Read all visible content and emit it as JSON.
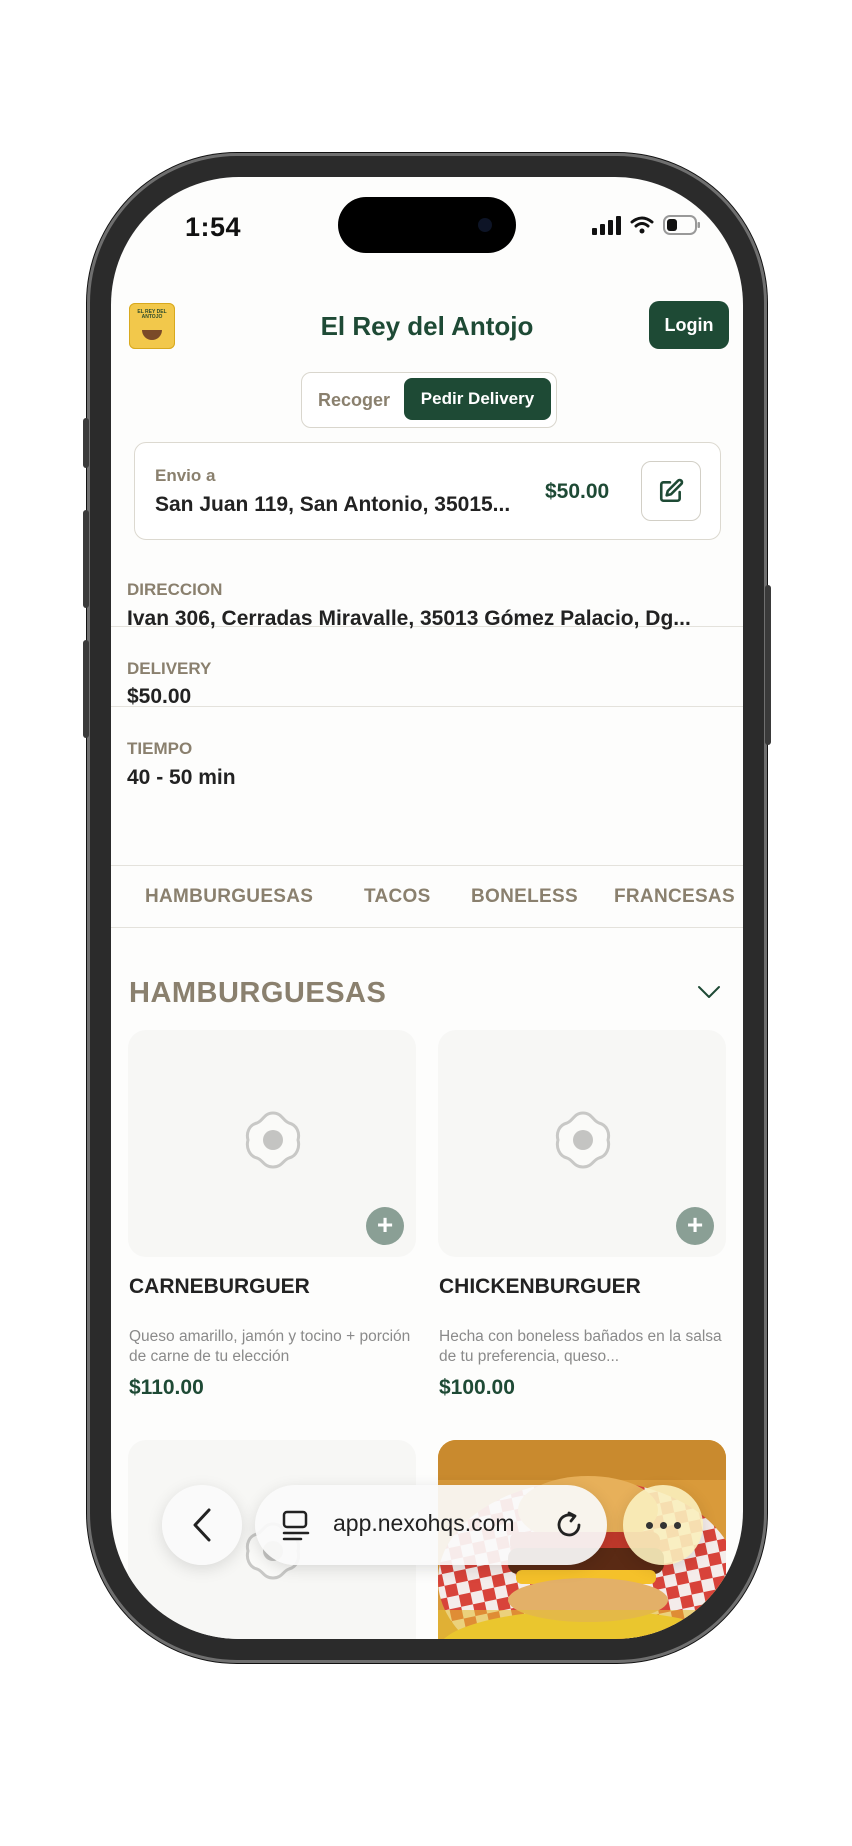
{
  "status": {
    "time": "1:54"
  },
  "header": {
    "title": "El Rey del Antojo",
    "login_label": "Login",
    "logo_text": "EL REY DEL ANTOJO"
  },
  "mode_toggle": {
    "pickup_label": "Recoger",
    "delivery_label": "Pedir Delivery",
    "selected": "delivery"
  },
  "address_card": {
    "label": "Envio a",
    "address": "San Juan 119, San Antonio, 35015...",
    "price": "$50.00"
  },
  "info": [
    {
      "label": "DIRECCION",
      "value": "Ivan 306, Cerradas Miravalle, 35013 Gómez Palacio, Dg..."
    },
    {
      "label": "DELIVERY",
      "value": "$50.00"
    },
    {
      "label": "TIEMPO",
      "value": "40 - 50 min"
    }
  ],
  "categories": [
    "HAMBURGUESAS",
    "TACOS",
    "BONELESS",
    "FRANCESAS"
  ],
  "section": {
    "title": "HAMBURGUESAS"
  },
  "products": [
    {
      "name": "CARNEBURGUER",
      "description": "Queso amarillo, jamón y tocino + porción de carne de tu elección",
      "price": "$110.00"
    },
    {
      "name": "CHICKENBURGUER",
      "description": "Hecha con boneless bañados en la salsa de tu preferencia, queso...",
      "price": "$100.00"
    }
  ],
  "browser": {
    "url": "app.nexohqs.com"
  },
  "colors": {
    "brand": "#1e4a35",
    "muted": "#8a806e",
    "add_button": "#8a9f95"
  }
}
